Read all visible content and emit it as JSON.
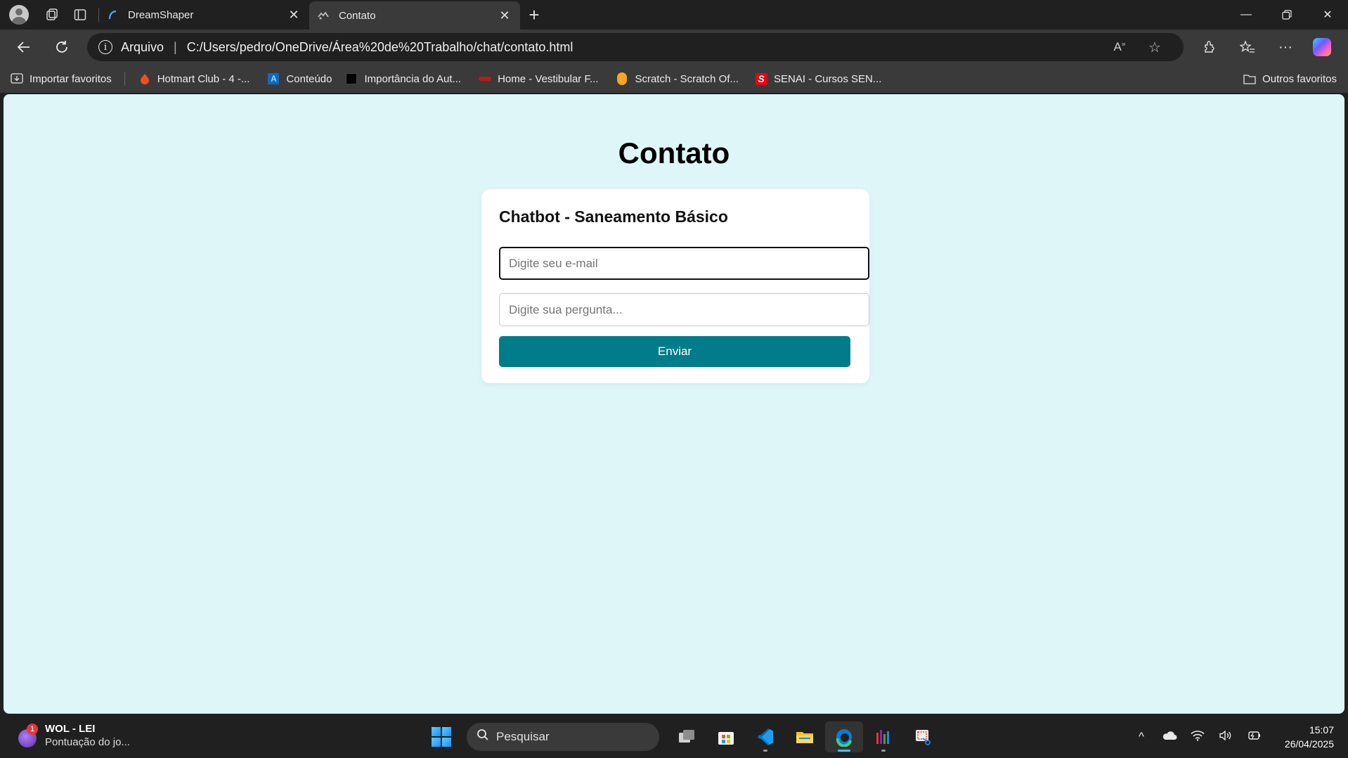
{
  "browser": {
    "tabs": [
      {
        "title": "DreamShaper",
        "active": false,
        "favicon": "dreamshaper-icon"
      },
      {
        "title": "Contato",
        "active": true,
        "favicon": "page-icon"
      }
    ],
    "address": {
      "security_label": "Arquivo",
      "url": "C:/Users/pedro/OneDrive/Área%20de%20Trabalho/chat/contato.html"
    },
    "bookmarks": [
      {
        "label": "Importar favoritos",
        "icon": "import-icon"
      },
      {
        "label": "Hotmart Club - 4 -...",
        "icon": "hotmart-icon"
      },
      {
        "label": "Conteúdo",
        "icon": "conteudo-icon"
      },
      {
        "label": "Importância do Aut...",
        "icon": "video-icon"
      },
      {
        "label": "Home - Vestibular F...",
        "icon": "vestibular-icon"
      },
      {
        "label": "Scratch - Scratch Of...",
        "icon": "scratch-icon"
      },
      {
        "label": "SENAI - Cursos SEN...",
        "icon": "senai-icon"
      }
    ],
    "other_favorites": "Outros favoritos"
  },
  "page": {
    "heading": "Contato",
    "card_title": "Chatbot - Saneamento Básico",
    "email_placeholder": "Digite seu e-mail",
    "question_placeholder": "Digite sua pergunta...",
    "submit_label": "Enviar",
    "colors": {
      "background": "#dff6f9",
      "button": "#007c8a"
    }
  },
  "taskbar": {
    "widget": {
      "title": "WOL - LEI",
      "subtitle": "Pontuação do jo...",
      "badge": "1"
    },
    "search_placeholder": "Pesquisar",
    "time": "15:07",
    "date": "26/04/2025"
  }
}
